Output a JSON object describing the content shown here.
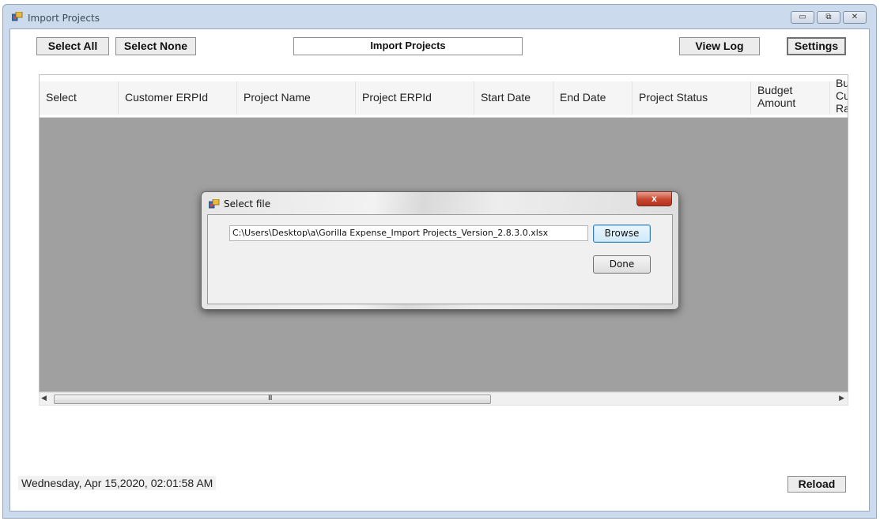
{
  "window": {
    "title": "Import Projects",
    "minimize_glyph": "▭",
    "maximize_glyph": "⧉",
    "close_glyph": "✕"
  },
  "toolbar": {
    "select_all": "Select All",
    "select_none": "Select None",
    "import_projects": "Import Projects",
    "view_log": "View Log",
    "settings": "Settings"
  },
  "grid": {
    "columns": [
      "Select",
      "Customer ERPId",
      "Project Name",
      "Project ERPId",
      "Start Date",
      "End Date",
      "Project Status",
      "Budget Amount",
      "Bu\nCu\nRa"
    ],
    "background_color": "#a0a0a0",
    "horizontal_scroll_fraction": 0.0,
    "scroll_grip": "III"
  },
  "status": {
    "datetime": "Wednesday, Apr 15,2020, 02:01:58 AM"
  },
  "reload_label": "Reload",
  "dialog": {
    "title": "Select file",
    "close_glyph": "x",
    "file_path": "C:\\Users\\Desktop\\a\\Gorilla Expense_Import Projects_Version_2.8.3.0.xlsx",
    "browse_label": "Browse",
    "done_label": "Done"
  },
  "icons": {
    "app": "app-window-icon",
    "dialog": "dialog-window-icon",
    "scroll_left": "scroll-left-arrow-icon",
    "scroll_right": "scroll-right-arrow-icon"
  },
  "colors": {
    "title_bar": "#cbdaec",
    "close_button": "#c8462f",
    "focused_button_border": "#3c7fb1"
  }
}
